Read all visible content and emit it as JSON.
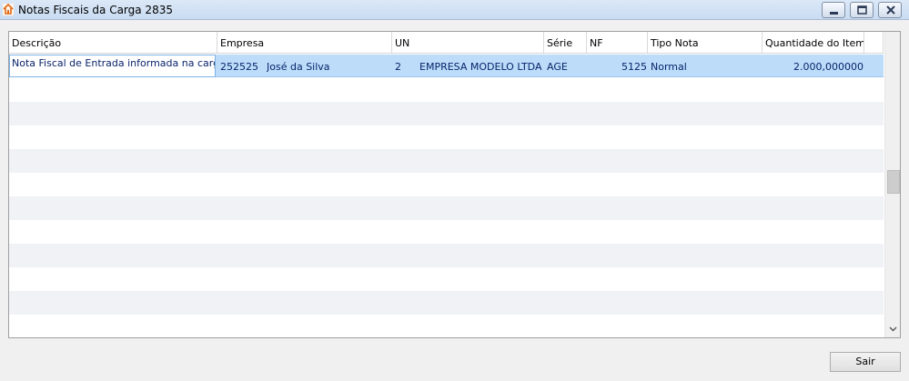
{
  "window": {
    "title": "Notas Fiscais da Carga 2835"
  },
  "grid": {
    "columns": [
      "Descrição",
      "Empresa",
      "UN",
      "Série",
      "NF",
      "Tipo Nota",
      "Quantidade do Item"
    ],
    "rows": [
      {
        "descricao": "Nota Fiscal de Entrada informada na carga",
        "empresa_codigo": "252525",
        "empresa_nome": "José da Silva",
        "un_codigo": "2",
        "un_nome": "EMPRESA MODELO LTDA",
        "serie": "AGE",
        "nf": "5125",
        "tipo_nota": "Normal",
        "quantidade": "2.000,000000"
      }
    ]
  },
  "buttons": {
    "sair": "Sair"
  },
  "icons": {
    "app": "app-icon",
    "minimize": "minimize-icon",
    "maximize": "maximize-icon",
    "close": "close-icon",
    "scroll_down": "chevron-down-icon"
  },
  "colors": {
    "selection": "#bcdcfa",
    "stripe": "#f1f2f6",
    "text_selected": "#0a246a"
  }
}
